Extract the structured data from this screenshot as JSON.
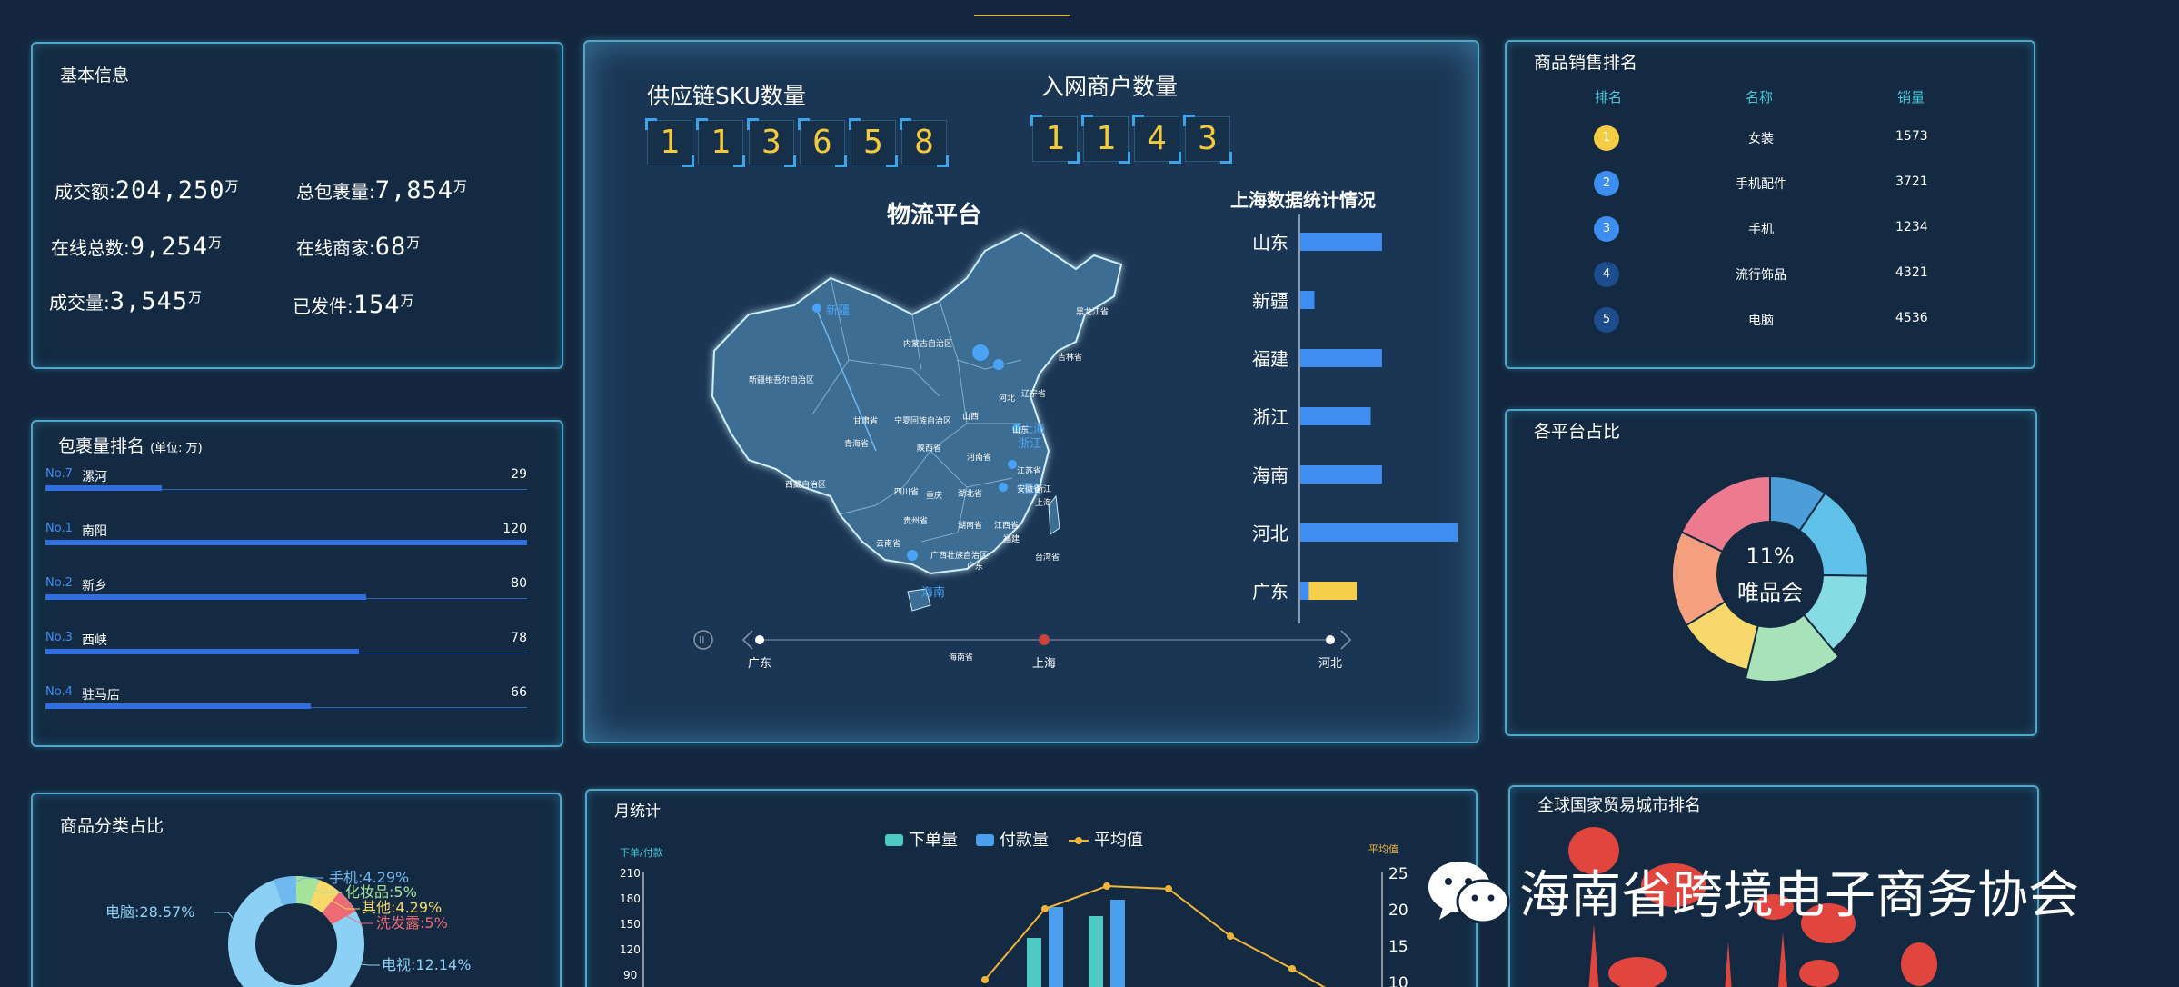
{
  "basic_info": {
    "title": "基本信息",
    "items": [
      {
        "label": "成交额:",
        "value": "204,250",
        "unit": "万"
      },
      {
        "label": "总包裹量:",
        "value": "7,854",
        "unit": "万"
      },
      {
        "label": "在线总数:",
        "value": "9,254",
        "unit": "万"
      },
      {
        "label": "在线商家:",
        "value": "68",
        "unit": "万"
      },
      {
        "label": "成交量:",
        "value": "3,545",
        "unit": "万"
      },
      {
        "label": "已发件:",
        "value": "154",
        "unit": "万"
      }
    ]
  },
  "package_rank": {
    "title": "包裹量排名",
    "unit": "(单位: 万)",
    "max": 120,
    "rows": [
      {
        "no": "No.7",
        "name": "漯河",
        "value": 29
      },
      {
        "no": "No.1",
        "name": "南阳",
        "value": 120
      },
      {
        "no": "No.2",
        "name": "新乡",
        "value": 80
      },
      {
        "no": "No.3",
        "name": "西峡",
        "value": 78
      },
      {
        "no": "No.4",
        "name": "驻马店",
        "value": 66
      }
    ]
  },
  "category_share": {
    "title": "商品分类占比",
    "labels": [
      {
        "text": "手机:4.29%",
        "color": "#6fb8f0"
      },
      {
        "text": "化妆品:5%",
        "color": "#a6e39a"
      },
      {
        "text": "其他:4.29%",
        "color": "#f7d969"
      },
      {
        "text": "洗发露:5%",
        "color": "#ee6a74"
      },
      {
        "text": "电脑:28.57%",
        "color": "#8dd0f5"
      },
      {
        "text": "电视:12.14%",
        "color": "#8dd0f5"
      }
    ]
  },
  "center": {
    "sku_title": "供应链SKU数量",
    "sku_digits": [
      "1",
      "1",
      "3",
      "6",
      "5",
      "8"
    ],
    "merchant_title": "入网商户数量",
    "merchant_digits": [
      "1",
      "1",
      "4",
      "3"
    ],
    "map_title": "物流平台",
    "map_labels": [
      "黑龙江省",
      "吉林省",
      "内蒙古自治区",
      "辽宁省",
      "新疆维吾尔自治区",
      "甘肃省",
      "宁夏回族自治区",
      "山西",
      "河北",
      "山东",
      "青海省",
      "陕西省",
      "河南省",
      "江苏省",
      "西藏自治区",
      "四川省",
      "重庆",
      "湖北省",
      "安徽省",
      "浙江",
      "上海",
      "贵州省",
      "湖南省",
      "江西省",
      "福建",
      "云南省",
      "广西壮族自治区",
      "广东",
      "台湾省",
      "海南省"
    ],
    "map_city_tags": [
      "新疆",
      "海南",
      "上海",
      "浙江",
      "福建"
    ],
    "stats_title": "上海数据统计情况",
    "stats": [
      {
        "name": "山东",
        "blue": 58,
        "yellow": 0
      },
      {
        "name": "新疆",
        "blue": 10,
        "yellow": 0
      },
      {
        "name": "福建",
        "blue": 58,
        "yellow": 0
      },
      {
        "name": "浙江",
        "blue": 50,
        "yellow": 0
      },
      {
        "name": "海南",
        "blue": 58,
        "yellow": 0
      },
      {
        "name": "河北",
        "blue": 118,
        "yellow": 0
      },
      {
        "name": "广东",
        "blue": 6,
        "yellow": 34
      }
    ],
    "timeline": [
      "广东",
      "上海",
      "河北"
    ],
    "timeline_active": 1
  },
  "sales_rank": {
    "title": "商品销售排名",
    "headers": [
      "排名",
      "名称",
      "销量"
    ],
    "rows": [
      {
        "rank": "1",
        "name": "女装",
        "sales": "1573",
        "color": "#f5cd45"
      },
      {
        "rank": "2",
        "name": "手机配件",
        "sales": "3721",
        "color": "#3d8ef0"
      },
      {
        "rank": "3",
        "name": "手机",
        "sales": "1234",
        "color": "#3d8ef0"
      },
      {
        "rank": "4",
        "name": "流行饰品",
        "sales": "4321",
        "color": "#1d4d8c"
      },
      {
        "rank": "5",
        "name": "电脑",
        "sales": "4536",
        "color": "#1d4d8c"
      }
    ]
  },
  "platform_share": {
    "title": "各平台占比",
    "center_value": "11%",
    "center_name": "唯品会",
    "slices": [
      {
        "value": 9,
        "color": "#4c9ed8"
      },
      {
        "value": 15,
        "color": "#5fc0e8"
      },
      {
        "value": 13,
        "color": "#87dbe3"
      },
      {
        "value": 14,
        "color": "#a8e2b8"
      },
      {
        "value": 12,
        "color": "#f6d86b"
      },
      {
        "value": 15,
        "color": "#f4a07f"
      },
      {
        "value": 17,
        "color": "#ee7a90"
      }
    ]
  },
  "monthly": {
    "title": "月统计",
    "legend": [
      "下单量",
      "付款量",
      "平均值"
    ],
    "left_axis_label": "下单/付款",
    "right_axis_label": "平均值",
    "left_ticks": [
      "210",
      "180",
      "150",
      "120",
      "90"
    ],
    "right_ticks": [
      "25",
      "20",
      "15",
      "10"
    ],
    "colors": {
      "order": "#4ec9c4",
      "pay": "#4a9fec",
      "avg": "#f2b53a"
    }
  },
  "global_rank": {
    "title": "全球国家贸易城市排名"
  },
  "watermark": {
    "text": "海南省跨境电子商务协会"
  },
  "chart_data": [
    {
      "type": "bar",
      "title": "包裹量排名",
      "categories": [
        "漯河",
        "南阳",
        "新乡",
        "西峡",
        "驻马店"
      ],
      "values": [
        29,
        120,
        80,
        78,
        66
      ]
    },
    {
      "type": "bar",
      "title": "上海数据统计情况",
      "categories": [
        "山东",
        "新疆",
        "福建",
        "浙江",
        "海南",
        "河北",
        "广东"
      ],
      "values": [
        58,
        10,
        58,
        50,
        58,
        118,
        40
      ]
    },
    {
      "type": "pie",
      "title": "各平台占比",
      "values": [
        9,
        15,
        13,
        14,
        12,
        15,
        17
      ]
    }
  ]
}
